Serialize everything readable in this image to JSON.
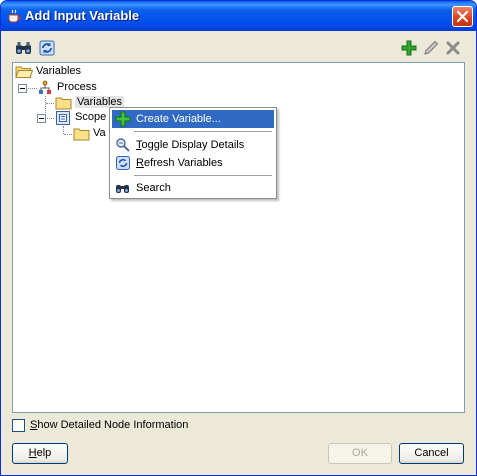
{
  "window": {
    "title": "Add Input Variable"
  },
  "toolbar": {
    "left_icons": [
      "binoculars-icon",
      "refresh-icon"
    ],
    "right_icons": [
      "add-icon",
      "edit-icon",
      "delete-icon"
    ]
  },
  "tree": {
    "root": "Variables",
    "process": "Process",
    "process_variables": "Variables",
    "scope": "Scope",
    "scope_variables_partial": "Va"
  },
  "context_menu": {
    "items": [
      {
        "label": "Create Variable...",
        "icon": "add-icon"
      },
      {
        "mnemonic": "T",
        "rest": "oggle Display Details",
        "icon": "toggle-details-icon"
      },
      {
        "mnemonic": "R",
        "rest": "efresh Variables",
        "icon": "refresh-icon"
      },
      {
        "label": "Search",
        "icon": "binoculars-icon"
      }
    ]
  },
  "options": {
    "show_details": {
      "mnemonic": "S",
      "rest": "how Detailed Node Information",
      "checked": false
    }
  },
  "buttons": {
    "help": {
      "mnemonic": "H",
      "rest": "elp"
    },
    "ok": "OK",
    "cancel": "Cancel"
  },
  "colors": {
    "title_bar": "#0050ee",
    "menu_highlight": "#316ac5",
    "dialog_bg": "#ece9d8"
  }
}
